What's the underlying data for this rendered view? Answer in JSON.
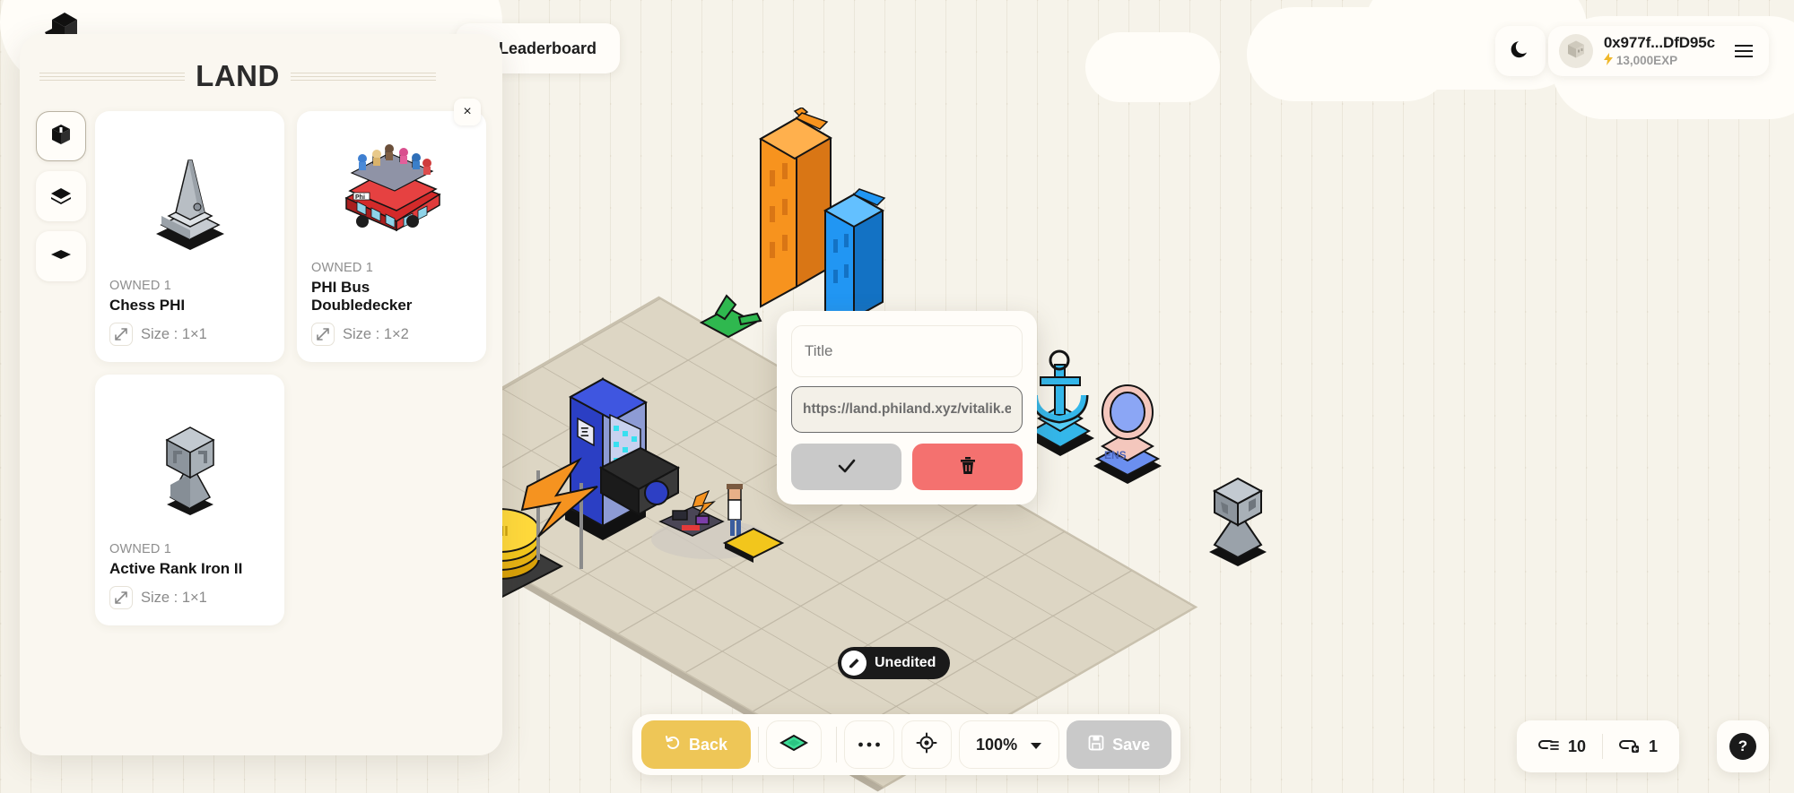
{
  "app": {
    "logo_icon": "phi-cube-logo-icon",
    "background_color": "#f6f3ea"
  },
  "leaderboard": {
    "label": "Leaderboard",
    "icon": "trophy-icon"
  },
  "land_panel": {
    "title": "LAND",
    "close_label": "×",
    "tools": [
      {
        "name": "object-tool",
        "icon": "cube-icon",
        "active": true
      },
      {
        "name": "layers-tool",
        "icon": "layers-icon",
        "active": false
      },
      {
        "name": "ground-tool",
        "icon": "diamond-icon",
        "active": false
      }
    ],
    "items": [
      {
        "owned": "OWNED 1",
        "name": "Chess PHI",
        "size": "Size : 1×1",
        "thumb": "chess-pawn-monument-icon",
        "size_icon": "resize-arrow-icon"
      },
      {
        "owned": "OWNED 1",
        "name": "PHI Bus Doubledecker",
        "size": "Size : 1×2",
        "thumb": "red-doubledecker-bus-icon",
        "size_icon": "resize-arrow-icon"
      },
      {
        "owned": "OWNED 1",
        "name": "Active Rank Iron II",
        "size": "Size : 1×1",
        "thumb": "iron-rank-trophy-icon",
        "size_icon": "resize-arrow-icon"
      }
    ]
  },
  "edit_dialog": {
    "title_placeholder": "Title",
    "title_value": "",
    "url_value": "https://land.philand.xyz/vitalik.eth",
    "confirm_icon": "check-icon",
    "delete_icon": "trash-icon"
  },
  "status_badge": {
    "label": "Unedited",
    "icon": "pencil-icon"
  },
  "toolbar": {
    "back_label": "Back",
    "back_icon": "undo-arrow-icon",
    "back_color": "#eec657",
    "tile_icon": "green-diamond-tile-icon",
    "more_icon": "ellipsis-icon",
    "target_icon": "crosshair-icon",
    "zoom_value": "100%",
    "zoom_caret_icon": "caret-down-icon",
    "save_label": "Save",
    "save_icon": "floppy-disk-icon",
    "save_color": "#c9c9c9"
  },
  "footer_stats": {
    "items": [
      {
        "icon": "link-list-icon",
        "value": "10"
      },
      {
        "icon": "link-add-icon",
        "value": "1"
      }
    ],
    "help_label": "?"
  },
  "account": {
    "theme_icon": "moon-icon",
    "avatar_icon": "cube-avatar-icon",
    "address": "0x977f...DfD95c",
    "exp": "13,000EXP",
    "exp_icon": "lightning-bolt-icon",
    "menu_icon": "hamburger-menu-icon"
  },
  "scene": {
    "objects": [
      {
        "name": "coin-stack-object",
        "color": "#f3c61b"
      },
      {
        "name": "orange-lightning-object",
        "color": "#f59320"
      },
      {
        "name": "camera-object",
        "color": "#1b1b1b"
      },
      {
        "name": "pixel-person-object",
        "color": "#ffffff"
      },
      {
        "name": "blue-arcade-machine-object",
        "color": "#2b3fc4"
      },
      {
        "name": "orange-tower-object",
        "color": "#f68b1f"
      },
      {
        "name": "blue-tower-object",
        "color": "#1d9bf0"
      },
      {
        "name": "green-creature-object",
        "color": "#24b24a"
      },
      {
        "name": "cyan-anchor-object",
        "color": "#34b7ea"
      },
      {
        "name": "ens-statue-object",
        "color": "#6b8ff0"
      },
      {
        "name": "chess-knight-object",
        "color": "#8c9299"
      }
    ]
  }
}
